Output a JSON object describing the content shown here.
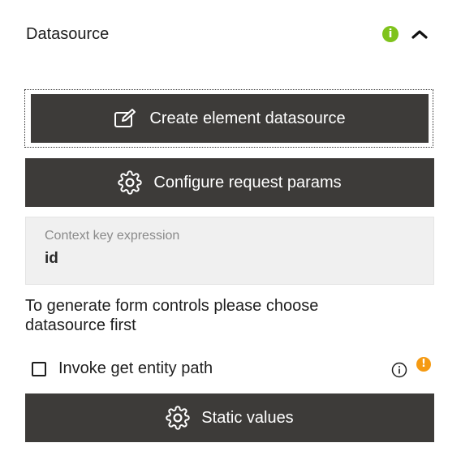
{
  "header": {
    "title": "Datasource",
    "info_icon_glyph": "i",
    "collapse_icon": "chevron-up-icon"
  },
  "buttons": {
    "create_label": "Create element datasource",
    "create_icon": "edit-icon",
    "configure_label": "Configure request params",
    "configure_icon": "gear-icon",
    "static_label": "Static values",
    "static_icon": "gear-icon"
  },
  "context_field": {
    "label": "Context key expression",
    "value": "id"
  },
  "hint_text": "To generate form controls please choose datasource first",
  "invoke_option": {
    "label": "Invoke get entity path",
    "checked": false,
    "warning_glyph": "!"
  },
  "colors": {
    "button_bg": "#3d3b39",
    "info_green": "#7fc31c",
    "warning_orange": "#f59a12",
    "field_bg": "#f0f0f0"
  }
}
